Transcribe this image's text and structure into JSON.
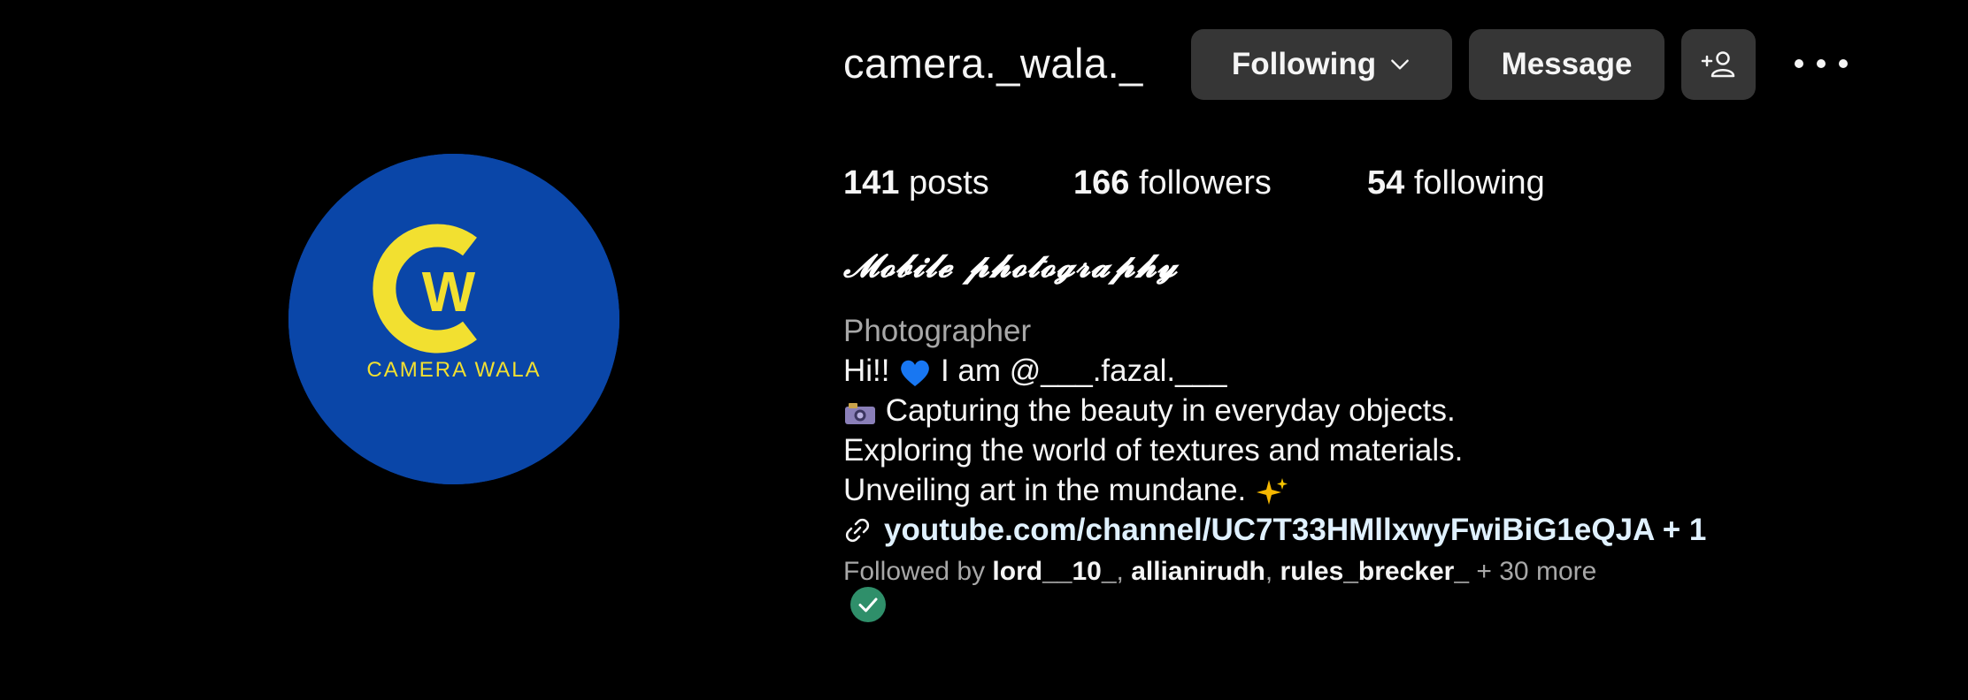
{
  "profile": {
    "username": "camera._wala._",
    "avatar_text": "CAMERA WALA",
    "avatar_monogram_c": "C",
    "avatar_monogram_w": "W",
    "full_name": "𝓜𝓸𝓫𝓲𝓵𝓮 𝓹𝓱𝓸𝓽𝓸𝓰𝓻𝓪𝓹𝓱𝔂",
    "category": "Photographer"
  },
  "actions": {
    "following_label": "Following",
    "message_label": "Message"
  },
  "stats": {
    "posts_count": "141",
    "posts_label": "posts",
    "followers_count": "166",
    "followers_label": "followers",
    "following_count": "54",
    "following_label": "following"
  },
  "bio": {
    "line1_pre": "Hi!!",
    "line1_post": "I am @___.fazal.___",
    "line2": "Capturing the beauty in everyday objects.",
    "line3": "Exploring the world of textures and materials.",
    "line4": "Unveiling art in the mundane."
  },
  "link": {
    "text": "youtube.com/channel/UC7T33HMllxwyFwiBiG1eQJA + 1"
  },
  "followed_by": {
    "prefix": "Followed by",
    "users": [
      "lord__10_",
      "allianirudh",
      "rules_brecker_"
    ],
    "more": "+ 30 more"
  },
  "colors": {
    "background": "#000000",
    "button_bg": "#363636",
    "avatar_blue": "#0a46a8",
    "avatar_yellow": "#f2e030",
    "muted_text": "#a8a8a8",
    "link_text": "#e0f1ff",
    "badge_green": "#2f8f6a"
  },
  "icons": {
    "following_button": "chevron-down-icon",
    "add_user_button": "add-user-icon",
    "more_button": "more-options-icon",
    "link": "link-icon",
    "heart": "blue-heart-icon",
    "camera": "camera-icon",
    "sparkles": "sparkles-icon",
    "badge": "check-badge-icon"
  }
}
